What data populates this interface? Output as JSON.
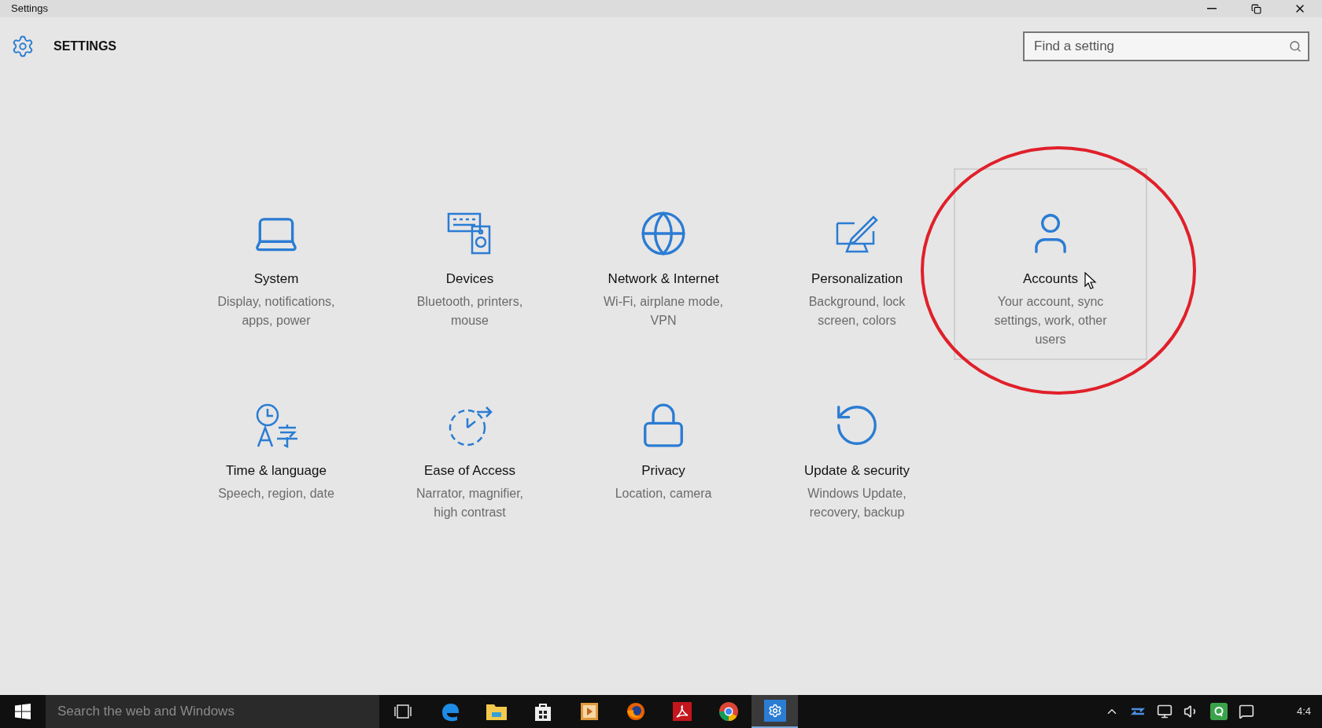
{
  "window": {
    "title": "Settings"
  },
  "header": {
    "title": "SETTINGS",
    "search": {
      "placeholder": "Find a setting"
    }
  },
  "categories": [
    {
      "kind": "system",
      "title": "System",
      "description": "Display, notifications, apps, power",
      "selected": false
    },
    {
      "kind": "devices",
      "title": "Devices",
      "description": "Bluetooth, printers, mouse",
      "selected": false
    },
    {
      "kind": "network",
      "title": "Network & Internet",
      "description": "Wi-Fi, airplane mode, VPN",
      "selected": false
    },
    {
      "kind": "personalization",
      "title": "Personalization",
      "description": "Background, lock screen, colors",
      "selected": false
    },
    {
      "kind": "accounts",
      "title": "Accounts",
      "description": "Your account, sync settings, work, other users",
      "selected": true
    },
    {
      "kind": "time",
      "title": "Time & language",
      "description": "Speech, region, date",
      "selected": false
    },
    {
      "kind": "ease",
      "title": "Ease of Access",
      "description": "Narrator, magnifier, high contrast",
      "selected": false
    },
    {
      "kind": "privacy",
      "title": "Privacy",
      "description": "Location, camera",
      "selected": false
    },
    {
      "kind": "update",
      "title": "Update & security",
      "description": "Windows Update, recovery, backup",
      "selected": false
    }
  ],
  "taskbar": {
    "search": {
      "placeholder": "Search the web and Windows"
    },
    "apps": [
      {
        "kind": "edge",
        "selected": false
      },
      {
        "kind": "explorer",
        "selected": false
      },
      {
        "kind": "store",
        "selected": false
      },
      {
        "kind": "media",
        "selected": false
      },
      {
        "kind": "firefox",
        "selected": false
      },
      {
        "kind": "acrobat",
        "selected": false
      },
      {
        "kind": "chrome",
        "selected": false
      },
      {
        "kind": "settings",
        "selected": true
      }
    ],
    "clock": "4:4"
  }
}
